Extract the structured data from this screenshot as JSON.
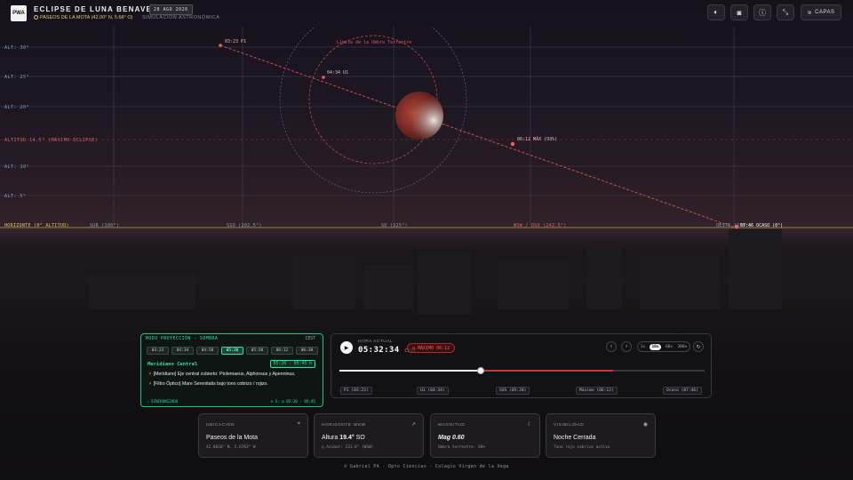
{
  "header": {
    "logo": "PWA",
    "title": "ECLIPSE DE LUNA BENAVENTE",
    "date": "28 AGO 2026",
    "location": "PASEOS DE LA MOTA (42.00° N, 5.68° O)",
    "mode": "SIMULACIÓN ASTRONÓMICA",
    "layers_button": "CAPAS"
  },
  "sky": {
    "altitudes": [
      "ALT: 30°",
      "ALT: 25°",
      "ALT: 20°",
      "ALTITUD 14.5° (MÁXIMO ECLIPSE)",
      "ALT: 10°",
      "ALT: 5°"
    ],
    "horizon": "HORIZONTE (0° ALTITUD)",
    "azimuths": [
      "SUR (180°)",
      "SSO (202.5°)",
      "SO (225°)",
      "WSW / OSO (242.5°)",
      "OESTE (270°)"
    ],
    "events": {
      "p1": "03:23 P1",
      "u1": "04:34 U1",
      "max": "06:12 MÁX (93%)",
      "set": "07:46 OCASO (0°)"
    },
    "umbra_label": "Límite de la Umbra Terrestre"
  },
  "projection": {
    "header": "MODO PROYECCIÓN - SOMBRA",
    "timezone": "CEST",
    "times": [
      "03:23",
      "04:34",
      "04:58",
      "05:20",
      "05:50",
      "06:12",
      "06:38"
    ],
    "active_time": "05:20",
    "section_title": "Meridiano Central",
    "section_range": "05:20 - 05:45 h",
    "bullets": [
      "[Meridiano] Eje central cubierto: Ptolemaeus, Alphonsus y Apenninus.",
      "[Filtro Óptico] Mare Serenitatis bajo tono cobrizo / rojizo."
    ],
    "sync": "SINCRONIZADO",
    "sync_range": "5: a 05:20 - 05:45"
  },
  "timeline": {
    "current_label": "HORA ACTUAL",
    "current_time": "05:32:34",
    "tz": "CEST",
    "max_badge": "MÁXIMO 06:12",
    "speeds": [
      "1x",
      "10x",
      "60x",
      "300x"
    ],
    "selected_speed": "10x",
    "progress": 0.387,
    "marks": [
      "P1 (03:23)",
      "U1 (04:34)",
      "SOS (05:20)",
      "Máximo (06:12)",
      "Ocaso (07:46)"
    ]
  },
  "cards": [
    {
      "label": "UBICACIÓN",
      "value": "Paseos de la Mota",
      "sub": "42.0010° N, 5.6783° W",
      "icon": "pin-icon"
    },
    {
      "label": "HORIZONTE WSW",
      "value_prefix": "Altura",
      "value": "19.4°",
      "value_suffix": "SO",
      "sub": "Azimut: 231.0° (WSW)",
      "icon": "arrow-up-right-icon"
    },
    {
      "label": "MAGNITUD",
      "value": "Mag 0.60",
      "sub": "Umbra terrestre: 60%",
      "icon": "moon-icon"
    },
    {
      "label": "VISIBILIDAD",
      "value": "Noche Cerrada",
      "sub": "Tono rojo cobrizo activo",
      "icon": "eye-icon"
    }
  ],
  "footer": "© Gabriel PA - Dpto Ciencias - Colegio Virgen de la Vega",
  "colors": {
    "accent_green": "#30e39e",
    "eclipse_red": "#c23a3a",
    "alt_blue": "#7aa3c8"
  }
}
